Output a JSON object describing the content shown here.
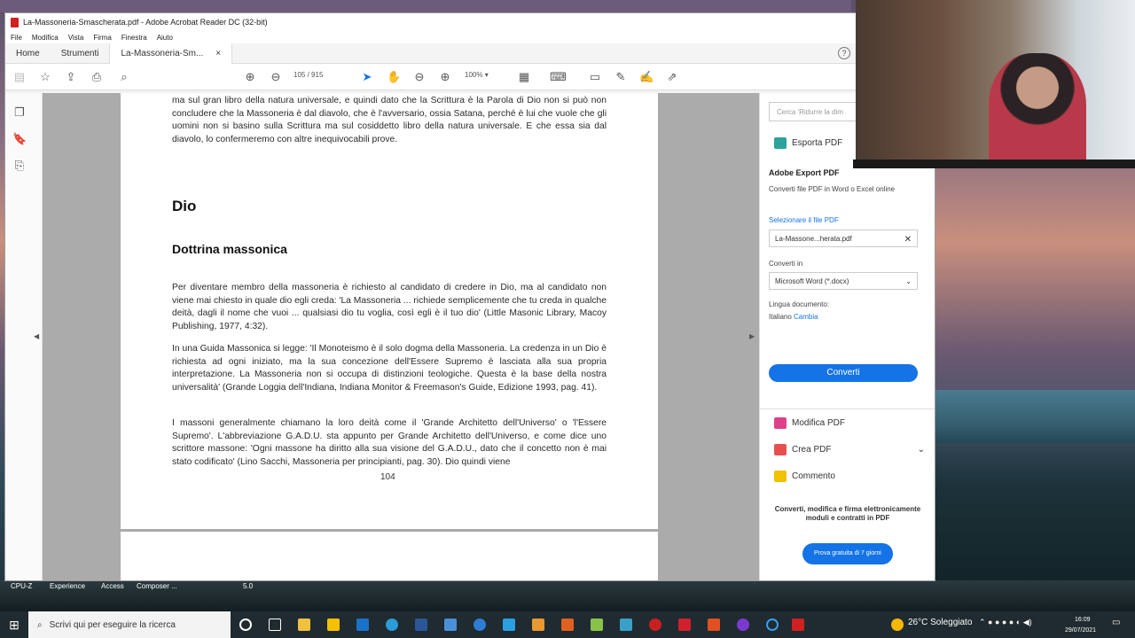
{
  "window": {
    "title": "La-Massoneria-Smascherata.pdf - Adobe Acrobat Reader DC (32-bit)"
  },
  "menu": [
    "File",
    "Modifica",
    "Vista",
    "Firma",
    "Finestra",
    "Aiuto"
  ],
  "tabs": {
    "home": "Home",
    "tools": "Strumenti",
    "doc": "La-Massoneria-Sm...",
    "close": "×"
  },
  "help_icon": "?",
  "toolbar": {
    "page_current": "105",
    "page_total": "/ 915",
    "zoom": "100%"
  },
  "document": {
    "intro": "ma sul gran libro della natura universale, e quindi dato che la Scrittura è la Parola di Dio non si può non concludere che la Massoneria è dal diavolo, che è l'avversario, ossia Satana, perché è lui che vuole che gli uomini non si basino sulla Scrittura ma sul cosiddetto libro della natura universale. E che essa sia dal diavolo, lo confermeremo con altre inequivocabili prove.",
    "heading1": "Dio",
    "heading2": "Dottrina massonica",
    "p1": "Per diventare membro della massoneria è richiesto al candidato di credere in Dio, ma al candidato non viene mai chiesto in quale dio egli creda: 'La Massoneria ... richiede semplicemente che tu creda in qualche deità, dagli il nome che vuoi ... qualsiasi dio tu voglia, così egli è il tuo dio' (Little Masonic Library, Macoy Publishing, 1977, 4:32).",
    "p2": "In una Guida Massonica si legge: 'Il Monoteismo è il solo dogma della Massoneria. La credenza in un Dio è richiesta ad ogni iniziato, ma la sua concezione dell'Essere Supremo è lasciata alla sua propria interpretazione. La Massoneria non si occupa di distinzioni teologiche. Questa è la base della nostra universalità' (Grande Loggia dell'Indiana, Indiana Monitor & Freemason's Guide, Edizione 1993, pag. 41).",
    "p3": "I massoni generalmente chiamano la loro deità come il 'Grande Architetto dell'Universo' o 'l'Essere Supremo'. L'abbreviazione G.A.D.U. sta appunto per Grande Architetto dell'Universo, e come dice uno scrittore massone: 'Ogni massone ha diritto alla sua visione del G.A.D.U., dato che il concetto non è mai stato codificato' (Lino Sacchi, Massoneria per principianti, pag. 30). Dio quindi viene",
    "page_number": "104"
  },
  "right_panel": {
    "search_placeholder": "Cerca 'Ridurre la dim",
    "export_label": "Esporta PDF",
    "export_title": "Adobe Export PDF",
    "export_desc": "Converti file PDF in Word o Excel online",
    "select_label": "Selezionare il file PDF",
    "file_name": "La-Massone...herata.pdf",
    "convert_to_label": "Converti in",
    "format": "Microsoft Word (*.docx)",
    "language_label": "Lingua documento:",
    "language": "Italiano",
    "change": "Cambia",
    "convert_button": "Converti",
    "tools": [
      "Modifica PDF",
      "Crea PDF",
      "Commento"
    ],
    "promo": "Converti, modifica e firma elettronicamente moduli e contratti in PDF",
    "trial_button": "Prova gratuita di 7 giorni"
  },
  "desktop": {
    "gadgets": [
      "CPU-Z",
      "Experience",
      "Access",
      "Composer ...",
      "5.0"
    ]
  },
  "taskbar": {
    "search_placeholder": "Scrivi qui per eseguire la ricerca",
    "weather": "26°C Soleggiato",
    "time": "16:09",
    "date": "29/07/2021"
  }
}
